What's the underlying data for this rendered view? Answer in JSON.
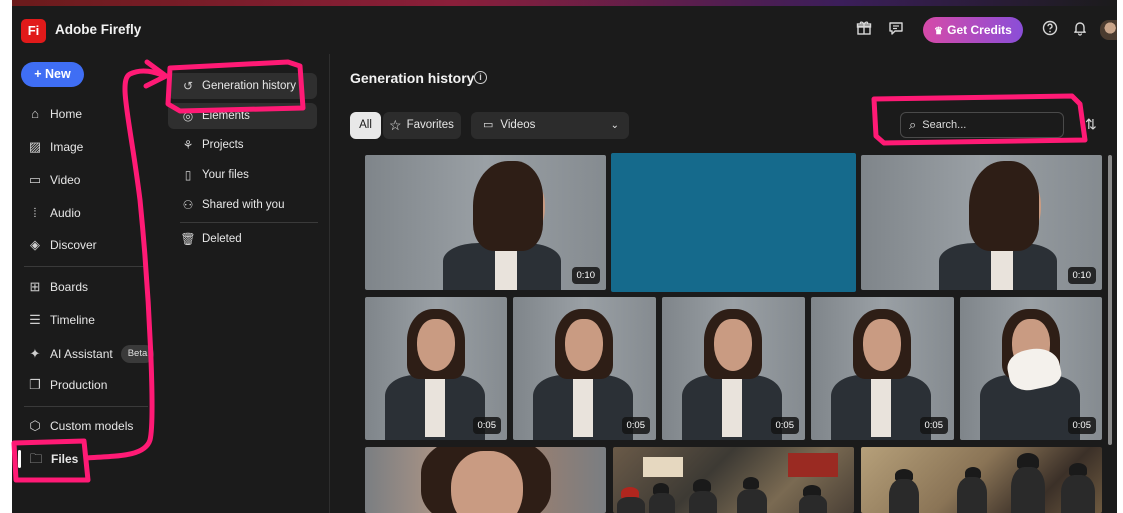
{
  "app": {
    "logo_text": "Fi",
    "name": "Adobe Firefly",
    "brand_color": "#e11a1a",
    "accent_color": "#3f6ef4"
  },
  "topbar": {
    "credits_label": "Get Credits",
    "icons": [
      "gift-icon",
      "chat-icon",
      "crown-icon",
      "help-icon",
      "bell-icon"
    ]
  },
  "nav": {
    "new_label": "New",
    "items": [
      {
        "label": "Home",
        "icon": "home-icon"
      },
      {
        "label": "Image",
        "icon": "image-icon"
      },
      {
        "label": "Video",
        "icon": "video-icon"
      },
      {
        "label": "Audio",
        "icon": "audio-icon"
      },
      {
        "label": "Discover",
        "icon": "discover-icon"
      },
      {
        "label": "Boards",
        "icon": "boards-icon"
      },
      {
        "label": "Timeline",
        "icon": "timeline-icon"
      },
      {
        "label": "AI Assistant",
        "icon": "sparkle-icon",
        "badge": "Beta"
      },
      {
        "label": "Production",
        "icon": "production-icon"
      },
      {
        "label": "Custom models",
        "icon": "custom-models-icon"
      },
      {
        "label": "Files",
        "icon": "folder-icon",
        "active": true
      }
    ]
  },
  "files_nav": {
    "items": [
      {
        "label": "Generation history",
        "icon": "history-icon",
        "active": true
      },
      {
        "label": "Elements",
        "icon": "elements-icon"
      },
      {
        "label": "Projects",
        "icon": "projects-icon"
      },
      {
        "label": "Your files",
        "icon": "file-icon"
      },
      {
        "label": "Shared with you",
        "icon": "shared-icon"
      },
      {
        "label": "Deleted",
        "icon": "trash-icon"
      }
    ]
  },
  "main": {
    "title": "Generation history",
    "filters": {
      "all_label": "All",
      "favorites_label": "Favorites",
      "type_selected": "Videos"
    },
    "search": {
      "placeholder": "Search..."
    },
    "thumbnails": [
      {
        "duration": "0:10",
        "kind": "woman-side"
      },
      {
        "duration": "",
        "kind": "teal-blank"
      },
      {
        "duration": "0:10",
        "kind": "woman-side"
      },
      {
        "duration": "0:05",
        "kind": "woman-front"
      },
      {
        "duration": "0:05",
        "kind": "woman-front"
      },
      {
        "duration": "0:05",
        "kind": "woman-front"
      },
      {
        "duration": "0:05",
        "kind": "woman-front"
      },
      {
        "duration": "0:05",
        "kind": "woman-sneeze"
      },
      {
        "duration": "",
        "kind": "woman-closeup"
      },
      {
        "duration": "",
        "kind": "firefighters-training"
      },
      {
        "duration": "",
        "kind": "firefighters-hall"
      }
    ]
  },
  "annotation_color": "#ff1a75"
}
